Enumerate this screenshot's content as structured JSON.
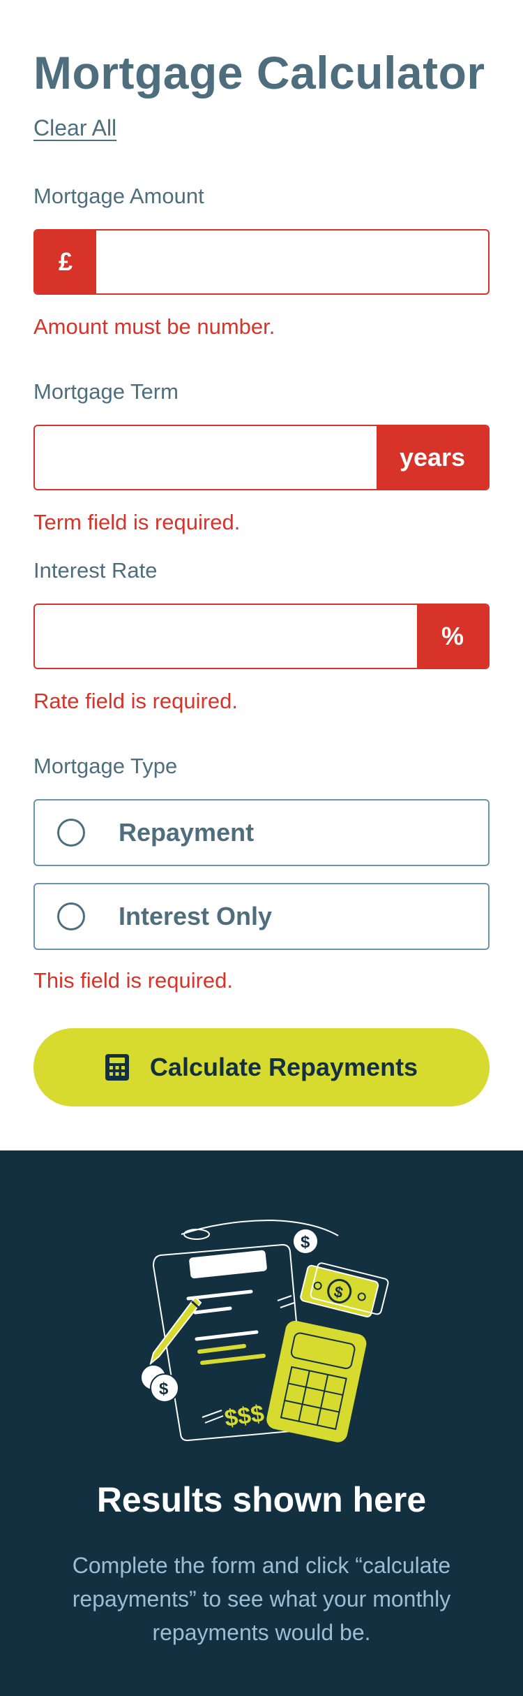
{
  "form": {
    "title": "Mortgage Calculator",
    "clear_all": "Clear All",
    "amount": {
      "label": "Mortgage Amount",
      "prefix": "£",
      "value": "",
      "error": "Amount must be number."
    },
    "term": {
      "label": "Mortgage Term",
      "suffix": "years",
      "value": "",
      "error": "Term field is required."
    },
    "rate": {
      "label": "Interest Rate",
      "suffix": "%",
      "value": "",
      "error": "Rate field is required."
    },
    "type": {
      "label": "Mortgage Type",
      "options": [
        {
          "label": "Repayment",
          "selected": false
        },
        {
          "label": "Interest Only",
          "selected": false
        }
      ],
      "error": "This field is required."
    },
    "submit_label": "Calculate Repayments",
    "submit_icon": "calculator-icon"
  },
  "results": {
    "illustration": "empty-results-illustration",
    "title": "Results shown here",
    "description": "Complete the form and click “calculate repayments” to see what your monthly repayments would be.",
    "illustration_text": "$$$"
  },
  "colors": {
    "heading": "#4e6e7e",
    "error": "#d73328",
    "accent": "#d7da2f",
    "results_bg": "#133041",
    "results_text": "#9abed5"
  }
}
